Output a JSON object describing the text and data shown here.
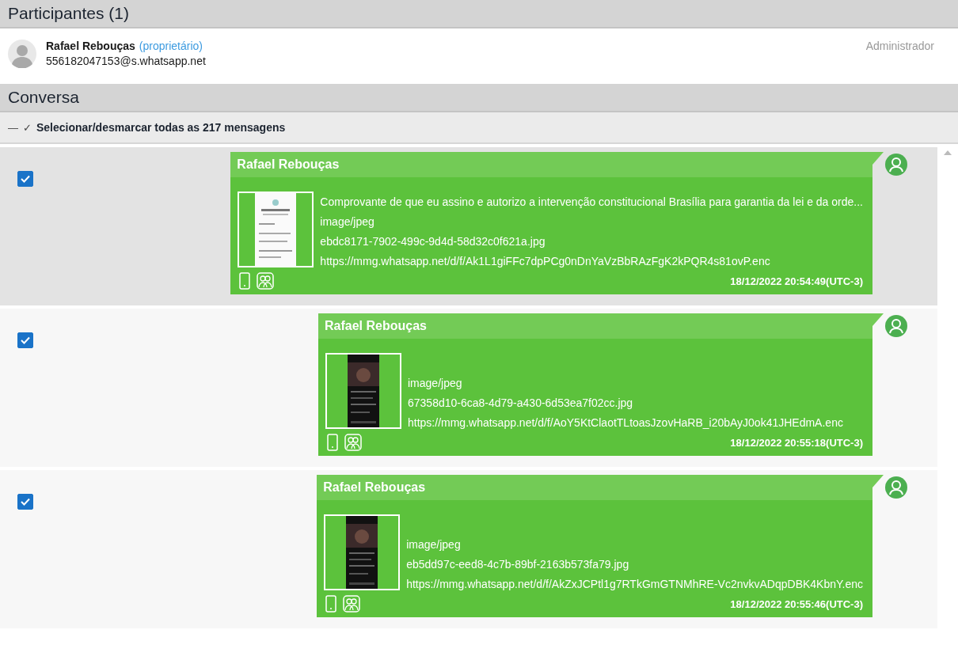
{
  "participants": {
    "title": "Participantes (1)",
    "items": [
      {
        "name": "Rafael Rebouças",
        "note": "(proprietário)",
        "id": "556182047153@s.whatsapp.net",
        "role": "Administrador"
      }
    ]
  },
  "conversation": {
    "title": "Conversa",
    "select_all": {
      "dash": "—",
      "check": "✓",
      "label": "Selecionar/desmarcar todas as 217 mensagens"
    },
    "messages": [
      {
        "selected": true,
        "checked": true,
        "sender": "Rafael Rebouças",
        "caption": "Comprovante de que eu assino e autorizo a intervenção constitucional Brasília para garantia da lei e da orde...",
        "mime": "image/jpeg",
        "file": "ebdc8171-7902-499c-9d4d-58d32c0f621a.jpg",
        "url": "https://mmg.whatsapp.net/d/f/Ak1L1giFFc7dpPCg0nDnYaVzBbRAzFgK2kPQR4s81ovP.enc",
        "time": "18/12/2022 20:54:49(UTC-3)"
      },
      {
        "selected": false,
        "checked": true,
        "sender": "Rafael Rebouças",
        "mime": "image/jpeg",
        "file": "67358d10-6ca8-4d79-a430-6d53ea7f02cc.jpg",
        "url": "https://mmg.whatsapp.net/d/f/AoY5KtClaotTLtoasJzovHaRB_i20bAyJ0ok41JHEdmA.enc",
        "time": "18/12/2022 20:55:18(UTC-3)"
      },
      {
        "selected": false,
        "checked": true,
        "sender": "Rafael Rebouças",
        "mime": "image/jpeg",
        "file": "eb5dd97c-eed8-4c7b-89bf-2163b573fa79.jpg",
        "url": "https://mmg.whatsapp.net/d/f/AkZxJCPtl1g7RTkGmGTNMhRE-Vc2nvkvADqpDBK4KbnY.enc",
        "time": "18/12/2022 20:55:46(UTC-3)"
      }
    ]
  }
}
